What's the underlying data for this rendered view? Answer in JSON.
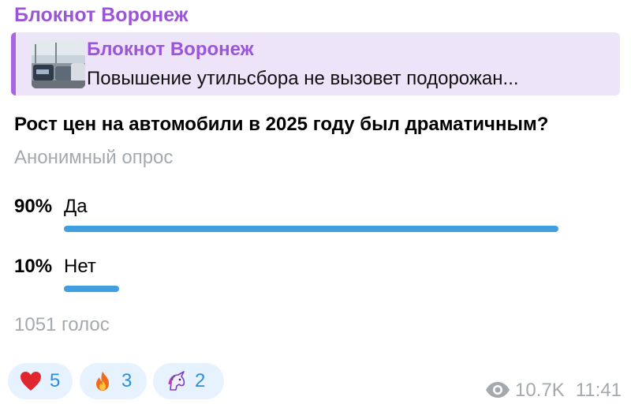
{
  "channel": {
    "name": "Блокнот Воронеж"
  },
  "reply": {
    "source": "Блокнот Воронеж",
    "text": "Повышение утильсбора не вызовет подорожан..."
  },
  "poll": {
    "question": "Рост цен на автомобили в 2025 году был драматичным?",
    "type_label": "Анонимный опрос",
    "options": [
      {
        "percent": "90%",
        "label": "Да",
        "share": 0.9
      },
      {
        "percent": "10%",
        "label": "Нет",
        "share": 0.1
      }
    ],
    "votes": "1051 голос",
    "bar_color": "#3f9fe0"
  },
  "reactions": [
    {
      "icon": "heart-icon",
      "count": "5"
    },
    {
      "icon": "fire-icon",
      "count": "3"
    },
    {
      "icon": "unicorn-icon",
      "count": "2"
    }
  ],
  "meta": {
    "views": "10.7K",
    "time": "11:41"
  },
  "colors": {
    "accent": "#9b55d9",
    "reply_bg": "#eee4f9",
    "reaction_bg": "#e6f2fd",
    "muted": "#a4a9ae"
  }
}
